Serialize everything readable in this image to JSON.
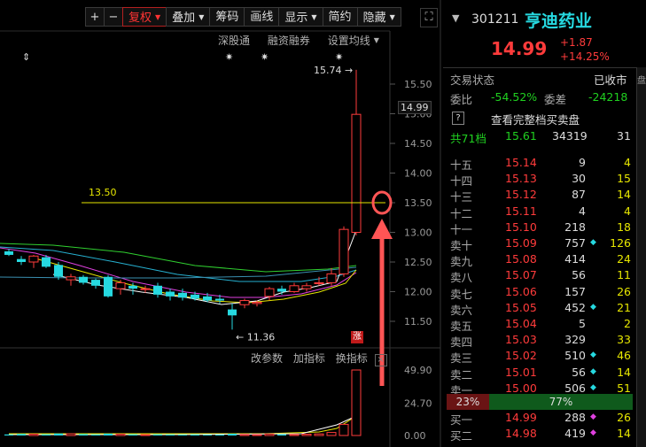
{
  "toolbar": {
    "buttons": [
      {
        "label": "+",
        "dropdown": false,
        "active": false
      },
      {
        "label": "−",
        "dropdown": false,
        "active": false
      },
      {
        "label": "复权",
        "dropdown": true,
        "active": true
      },
      {
        "label": "叠加",
        "dropdown": true,
        "active": false
      },
      {
        "label": "筹码",
        "dropdown": false,
        "active": false
      },
      {
        "label": "画线",
        "dropdown": false,
        "active": false
      },
      {
        "label": "显示",
        "dropdown": true,
        "active": false
      },
      {
        "label": "简约",
        "dropdown": false,
        "active": false
      },
      {
        "label": "隐藏",
        "dropdown": true,
        "active": false
      }
    ],
    "fullscreen_icon": "fullscreen-icon"
  },
  "sublinks": {
    "shen_gu_tong": "深股通",
    "rong_zi": "融资融券",
    "set_ma": "设置均线"
  },
  "chart": {
    "price_axis": [
      "15.50",
      "15.00",
      "14.50",
      "14.00",
      "13.50",
      "13.00",
      "12.50",
      "12.00",
      "11.50"
    ],
    "current_price_tag": "14.99",
    "high_label": "15.74",
    "low_label": "11.36",
    "line_label": "13.50",
    "limit_badge": "涨",
    "volume_axis": [
      "49.90",
      "24.70",
      "0.00"
    ],
    "indicator_links": {
      "change_params": "改参数",
      "add_indicator": "加指标",
      "swap_indicator": "换指标"
    },
    "colors": {
      "up": "#ff3b3b",
      "down": "#26d9e0",
      "ma5": "#ffffff",
      "ma10": "#e6e600",
      "ma20": "#e040e0",
      "ma60": "#30d030",
      "annot": "#ff5555"
    }
  },
  "chart_data": {
    "type": "candlestick",
    "candles": [
      {
        "o": 12.68,
        "h": 12.72,
        "l": 12.6,
        "c": 12.62
      },
      {
        "o": 12.55,
        "h": 12.6,
        "l": 12.45,
        "c": 12.5
      },
      {
        "o": 12.5,
        "h": 12.62,
        "l": 12.4,
        "c": 12.6
      },
      {
        "o": 12.58,
        "h": 12.62,
        "l": 12.4,
        "c": 12.42
      },
      {
        "o": 12.45,
        "h": 12.5,
        "l": 12.2,
        "c": 12.25
      },
      {
        "o": 12.2,
        "h": 12.3,
        "l": 12.1,
        "c": 12.25
      },
      {
        "o": 12.25,
        "h": 12.28,
        "l": 12.12,
        "c": 12.15
      },
      {
        "o": 12.2,
        "h": 12.22,
        "l": 12.05,
        "c": 12.1
      },
      {
        "o": 12.25,
        "h": 12.28,
        "l": 11.9,
        "c": 11.92
      },
      {
        "o": 12.05,
        "h": 12.2,
        "l": 11.95,
        "c": 12.15
      },
      {
        "o": 12.1,
        "h": 12.15,
        "l": 11.95,
        "c": 12.05
      },
      {
        "o": 12.05,
        "h": 12.1,
        "l": 11.98,
        "c": 12.05
      },
      {
        "o": 12.1,
        "h": 12.15,
        "l": 11.9,
        "c": 11.95
      },
      {
        "o": 12.0,
        "h": 12.05,
        "l": 11.85,
        "c": 11.92
      },
      {
        "o": 11.98,
        "h": 12.05,
        "l": 11.85,
        "c": 11.9
      },
      {
        "o": 11.95,
        "h": 12.0,
        "l": 11.85,
        "c": 11.88
      },
      {
        "o": 11.92,
        "h": 11.98,
        "l": 11.82,
        "c": 11.85
      },
      {
        "o": 11.88,
        "h": 11.95,
        "l": 11.8,
        "c": 11.85
      },
      {
        "o": 11.7,
        "h": 11.8,
        "l": 11.36,
        "c": 11.6
      },
      {
        "o": 11.78,
        "h": 11.88,
        "l": 11.72,
        "c": 11.85
      },
      {
        "o": 11.8,
        "h": 11.85,
        "l": 11.75,
        "c": 11.82
      },
      {
        "o": 11.92,
        "h": 12.08,
        "l": 11.85,
        "c": 12.05
      },
      {
        "o": 12.05,
        "h": 12.1,
        "l": 11.95,
        "c": 12.0
      },
      {
        "o": 12.0,
        "h": 12.15,
        "l": 11.98,
        "c": 12.1
      },
      {
        "o": 12.05,
        "h": 12.15,
        "l": 12.0,
        "c": 12.1
      },
      {
        "o": 12.15,
        "h": 12.25,
        "l": 12.1,
        "c": 12.15
      },
      {
        "o": 12.15,
        "h": 12.4,
        "l": 12.1,
        "c": 12.3
      },
      {
        "o": 12.3,
        "h": 13.1,
        "l": 12.25,
        "c": 13.05
      },
      {
        "o": 13.0,
        "h": 15.74,
        "l": 12.95,
        "c": 14.99
      }
    ],
    "volumes": [
      0.8,
      1.2,
      1.0,
      0.9,
      1.5,
      1.3,
      1.1,
      0.8,
      1.4,
      1.0,
      0.9,
      0.7,
      0.9,
      0.8,
      0.7,
      0.8,
      0.6,
      0.7,
      1.3,
      0.8,
      0.7,
      1.1,
      0.9,
      0.8,
      1.0,
      1.2,
      2.3,
      8.5,
      49.9
    ],
    "ylim": [
      11.36,
      15.74
    ],
    "reference_line": 13.5
  },
  "quote": {
    "code": "301211",
    "name": "亨迪药业",
    "price": "14.99",
    "change": "+1.87",
    "change_pct": "+14.25%",
    "status_label": "交易状态",
    "status_value": "已收市",
    "weibi_label": "委比",
    "weibi_value": "-54.52%",
    "weicha_label": "委差",
    "weicha_value": "-24218",
    "full_book_label": "查看完整档买卖盘",
    "question_mark": "?",
    "total_label": "共71档",
    "total_price": "15.61",
    "total_vol": "34319",
    "total_count": "31",
    "ratio_sell": "23%",
    "ratio_buy": "77%",
    "sell_levels": [
      {
        "label": "十五",
        "price": "15.14",
        "vol": "9",
        "mark": "",
        "count": "4"
      },
      {
        "label": "十四",
        "price": "15.13",
        "vol": "30",
        "mark": "",
        "count": "15"
      },
      {
        "label": "十三",
        "price": "15.12",
        "vol": "87",
        "mark": "",
        "count": "14"
      },
      {
        "label": "十二",
        "price": "15.11",
        "vol": "4",
        "mark": "",
        "count": "4"
      },
      {
        "label": "十一",
        "price": "15.10",
        "vol": "218",
        "mark": "",
        "count": "18"
      },
      {
        "label": "卖十",
        "price": "15.09",
        "vol": "757",
        "mark": "◆",
        "count": "126"
      },
      {
        "label": "卖九",
        "price": "15.08",
        "vol": "414",
        "mark": "",
        "count": "24"
      },
      {
        "label": "卖八",
        "price": "15.07",
        "vol": "56",
        "mark": "",
        "count": "11"
      },
      {
        "label": "卖七",
        "price": "15.06",
        "vol": "157",
        "mark": "",
        "count": "26"
      },
      {
        "label": "卖六",
        "price": "15.05",
        "vol": "452",
        "mark": "◆",
        "count": "21"
      },
      {
        "label": "卖五",
        "price": "15.04",
        "vol": "5",
        "mark": "",
        "count": "2"
      },
      {
        "label": "卖四",
        "price": "15.03",
        "vol": "329",
        "mark": "",
        "count": "33"
      },
      {
        "label": "卖三",
        "price": "15.02",
        "vol": "510",
        "mark": "◆",
        "count": "46"
      },
      {
        "label": "卖二",
        "price": "15.01",
        "vol": "56",
        "mark": "◆",
        "count": "14"
      },
      {
        "label": "卖一",
        "price": "15.00",
        "vol": "506",
        "mark": "◆",
        "count": "51"
      }
    ],
    "buy_levels": [
      {
        "label": "买一",
        "price": "14.99",
        "vol": "288",
        "mark": "◆",
        "count": "26"
      },
      {
        "label": "买二",
        "price": "14.98",
        "vol": "419",
        "mark": "◆",
        "count": "14"
      }
    ],
    "side_tab": "盘"
  }
}
